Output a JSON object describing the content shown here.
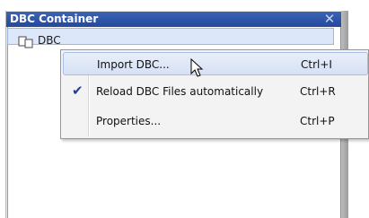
{
  "panel": {
    "title": "DBC Container",
    "tree_node_label": "DBC"
  },
  "context_menu": {
    "items": [
      {
        "label": "Import DBC...",
        "shortcut": "Ctrl+I",
        "checked": false,
        "highlighted": true
      },
      {
        "label": "Reload DBC Files automatically",
        "shortcut": "Ctrl+R",
        "checked": true,
        "highlighted": false
      },
      {
        "label": "Properties...",
        "shortcut": "Ctrl+P",
        "checked": false,
        "highlighted": false
      }
    ],
    "check_glyph": "✔"
  },
  "icons": {
    "close": "close-icon",
    "node": "tree-node-icon",
    "check": "check-icon",
    "cursor": "mouse-pointer-icon"
  },
  "colors": {
    "titlebar": "#2a4fa6",
    "highlight": "#d6e1f6",
    "check": "#1c3f9c"
  }
}
